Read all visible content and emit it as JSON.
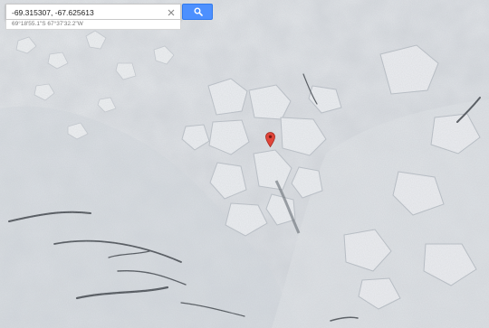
{
  "search": {
    "query": "-69.315307, -67.625613",
    "placeholder": "",
    "suggestion": "69°18'55.1\"S 67°37'32.2\"W"
  },
  "icons": {
    "clear": "close-icon",
    "search": "search-icon",
    "marker": "map-pin-icon"
  },
  "colors": {
    "accent": "#4d90fe",
    "marker": "#e0453a"
  }
}
